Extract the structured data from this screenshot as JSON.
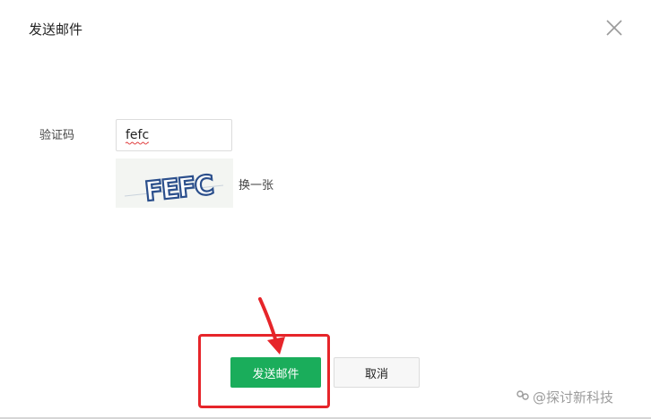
{
  "dialog": {
    "title": "发送邮件",
    "close_icon": "close-icon"
  },
  "form": {
    "captcha_label": "验证码",
    "captcha_value": "fefc",
    "captcha_image_text": "FEFC",
    "refresh_label": "换一张"
  },
  "buttons": {
    "send_label": "发送邮件",
    "cancel_label": "取消"
  },
  "annotation": {
    "highlight_color": "#e6252a"
  },
  "watermark": {
    "text": "@探讨新科技"
  },
  "colors": {
    "primary": "#1aad5b",
    "text": "#333333"
  }
}
